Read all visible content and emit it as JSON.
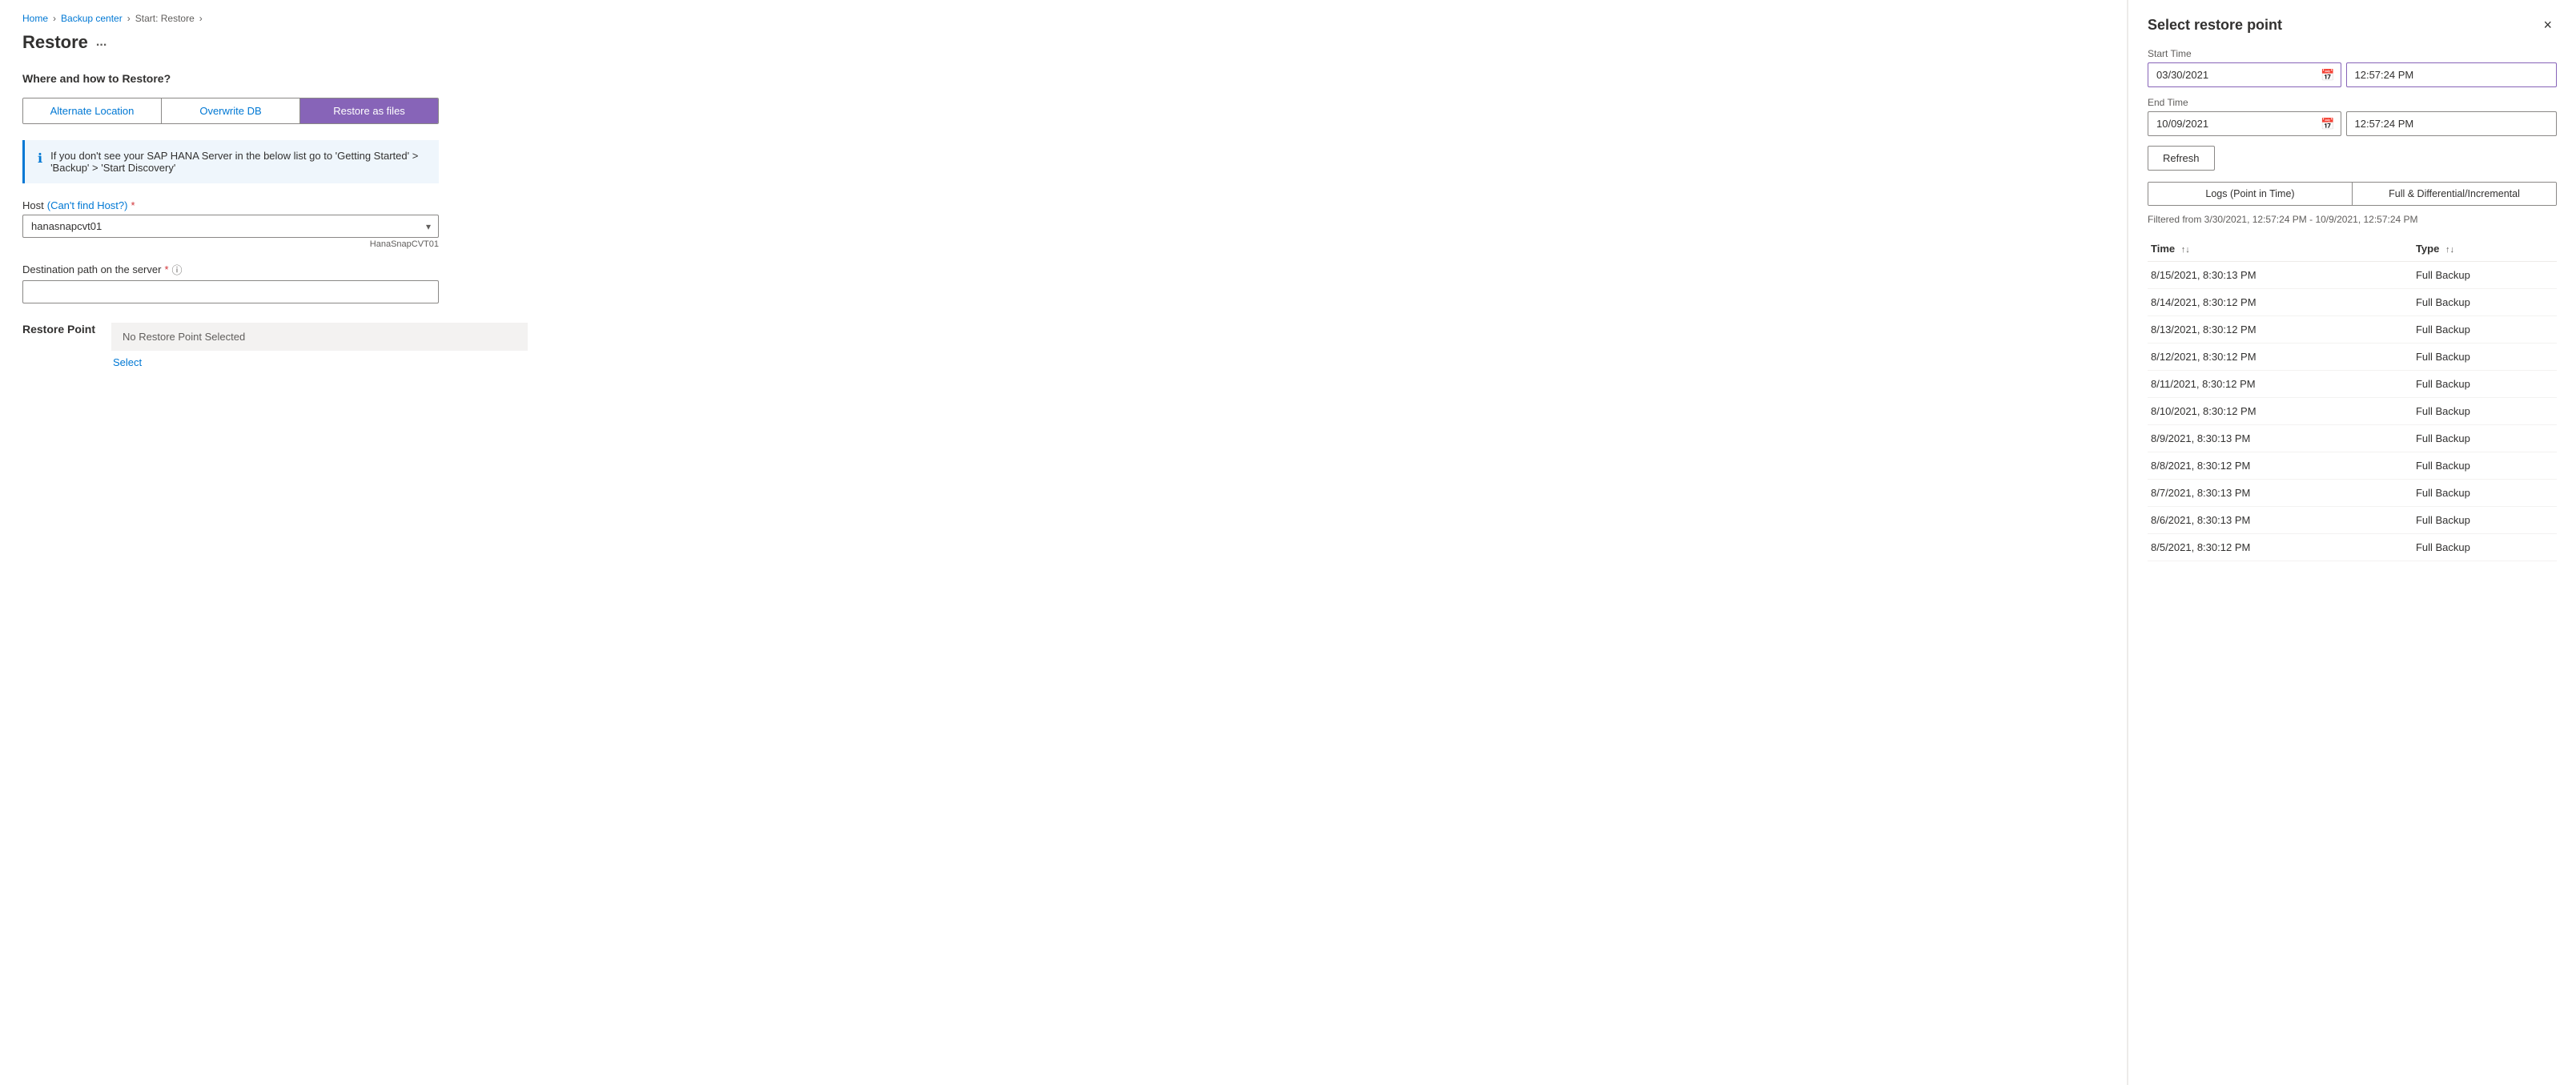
{
  "breadcrumb": {
    "items": [
      {
        "label": "Home",
        "href": "#"
      },
      {
        "label": "Backup center",
        "href": "#"
      },
      {
        "label": "Start: Restore",
        "href": "#"
      }
    ]
  },
  "page": {
    "title": "Restore",
    "ellipsis": "..."
  },
  "restore_form": {
    "section_heading": "Where and how to Restore?",
    "tabs": [
      {
        "label": "Alternate Location",
        "active": false
      },
      {
        "label": "Overwrite DB",
        "active": false
      },
      {
        "label": "Restore as files",
        "active": true
      }
    ],
    "info_message": "If you don't see your SAP HANA Server in the below list go to 'Getting Started' > 'Backup' > 'Start Discovery'",
    "host_label": "Host",
    "host_link_text": "(Can't find Host?)",
    "host_options": [
      "hanasnapcvt01"
    ],
    "host_selected": "hanasnapcvt01",
    "host_sublabel": "HanaSnapCVT01",
    "destination_label": "Destination path on the server",
    "destination_placeholder": "",
    "restore_point_heading": "Restore Point",
    "restore_point_value": "No Restore Point Selected",
    "select_link": "Select"
  },
  "right_panel": {
    "title": "Select restore point",
    "close_label": "×",
    "start_time_label": "Start Time",
    "start_date_value": "03/30/2021",
    "start_time_value": "12:57:24 PM",
    "end_time_label": "End Time",
    "end_date_value": "10/09/2021",
    "end_time_value": "12:57:24 PM",
    "refresh_label": "Refresh",
    "type_tabs": [
      {
        "label": "Logs (Point in Time)",
        "active": false
      },
      {
        "label": "Full & Differential/Incremental",
        "active": false
      }
    ],
    "filter_text": "Filtered from 3/30/2021, 12:57:24 PM - 10/9/2021, 12:57:24 PM",
    "table_headers": [
      {
        "label": "Time",
        "sortable": true
      },
      {
        "label": "Type",
        "sortable": true
      }
    ],
    "table_rows": [
      {
        "time": "8/15/2021, 8:30:13 PM",
        "type": "Full Backup"
      },
      {
        "time": "8/14/2021, 8:30:12 PM",
        "type": "Full Backup"
      },
      {
        "time": "8/13/2021, 8:30:12 PM",
        "type": "Full Backup"
      },
      {
        "time": "8/12/2021, 8:30:12 PM",
        "type": "Full Backup"
      },
      {
        "time": "8/11/2021, 8:30:12 PM",
        "type": "Full Backup"
      },
      {
        "time": "8/10/2021, 8:30:12 PM",
        "type": "Full Backup"
      },
      {
        "time": "8/9/2021, 8:30:13 PM",
        "type": "Full Backup"
      },
      {
        "time": "8/8/2021, 8:30:12 PM",
        "type": "Full Backup"
      },
      {
        "time": "8/7/2021, 8:30:13 PM",
        "type": "Full Backup"
      },
      {
        "time": "8/6/2021, 8:30:13 PM",
        "type": "Full Backup"
      },
      {
        "time": "8/5/2021, 8:30:12 PM",
        "type": "Full Backup"
      }
    ]
  }
}
